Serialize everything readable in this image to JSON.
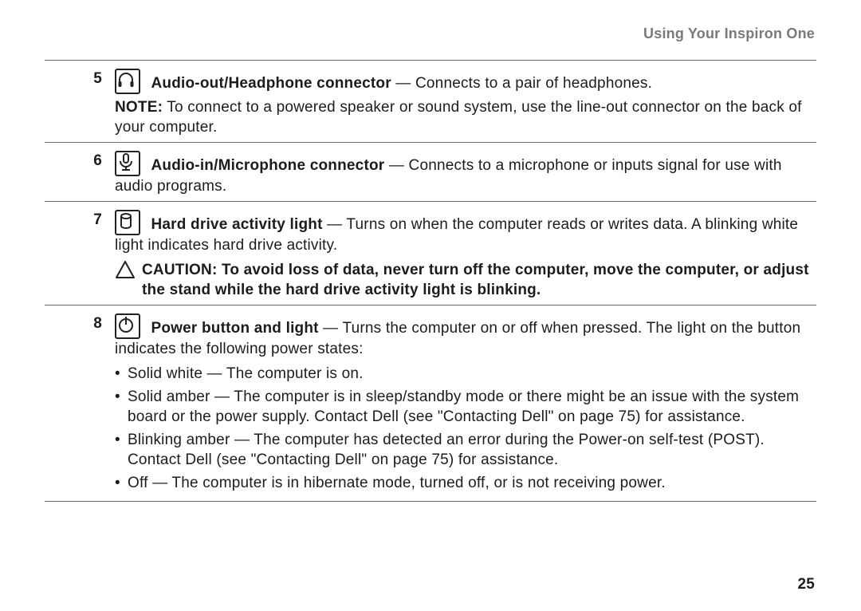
{
  "header": {
    "title": "Using Your Inspiron One"
  },
  "pageNumber": "25",
  "entries": {
    "e5": {
      "num": "5",
      "iconName": "headphone-icon",
      "title": "Audio-out/Headphone connector",
      "desc": " — Connects to a pair of headphones.",
      "noteLabel": "NOTE:",
      "noteText": " To connect to a powered speaker or sound system, use the line-out connector on the back of your computer."
    },
    "e6": {
      "num": "6",
      "iconName": "microphone-icon",
      "title": "Audio-in/Microphone connector",
      "desc": " — Connects to a microphone or inputs signal for use with audio programs."
    },
    "e7": {
      "num": "7",
      "iconName": "hard-drive-icon",
      "title": "Hard drive activity light",
      "desc": " — Turns on when the computer reads or writes data. A blinking white light indicates hard drive activity.",
      "cautionLabel": "CAUTION: To avoid loss of data, never turn off the computer, move the computer, or adjust the stand while the hard drive activity light is blinking."
    },
    "e8": {
      "num": "8",
      "iconName": "power-icon",
      "title": "Power button and light",
      "desc": " — Turns the computer on or off when pressed. The light on the button indicates the following power states:",
      "bullets": [
        "Solid white — The computer is on.",
        "Solid amber — The computer is in sleep/standby mode or there might be an issue with the system board or the power supply. Contact Dell (see \"Contacting Dell\" on page 75) for assistance.",
        "Blinking amber — The computer has detected an error during the Power-on self-test (POST). Contact Dell (see \"Contacting Dell\" on page 75) for assistance.",
        "Off — The computer is in hibernate mode, turned off, or is not receiving power."
      ]
    }
  }
}
